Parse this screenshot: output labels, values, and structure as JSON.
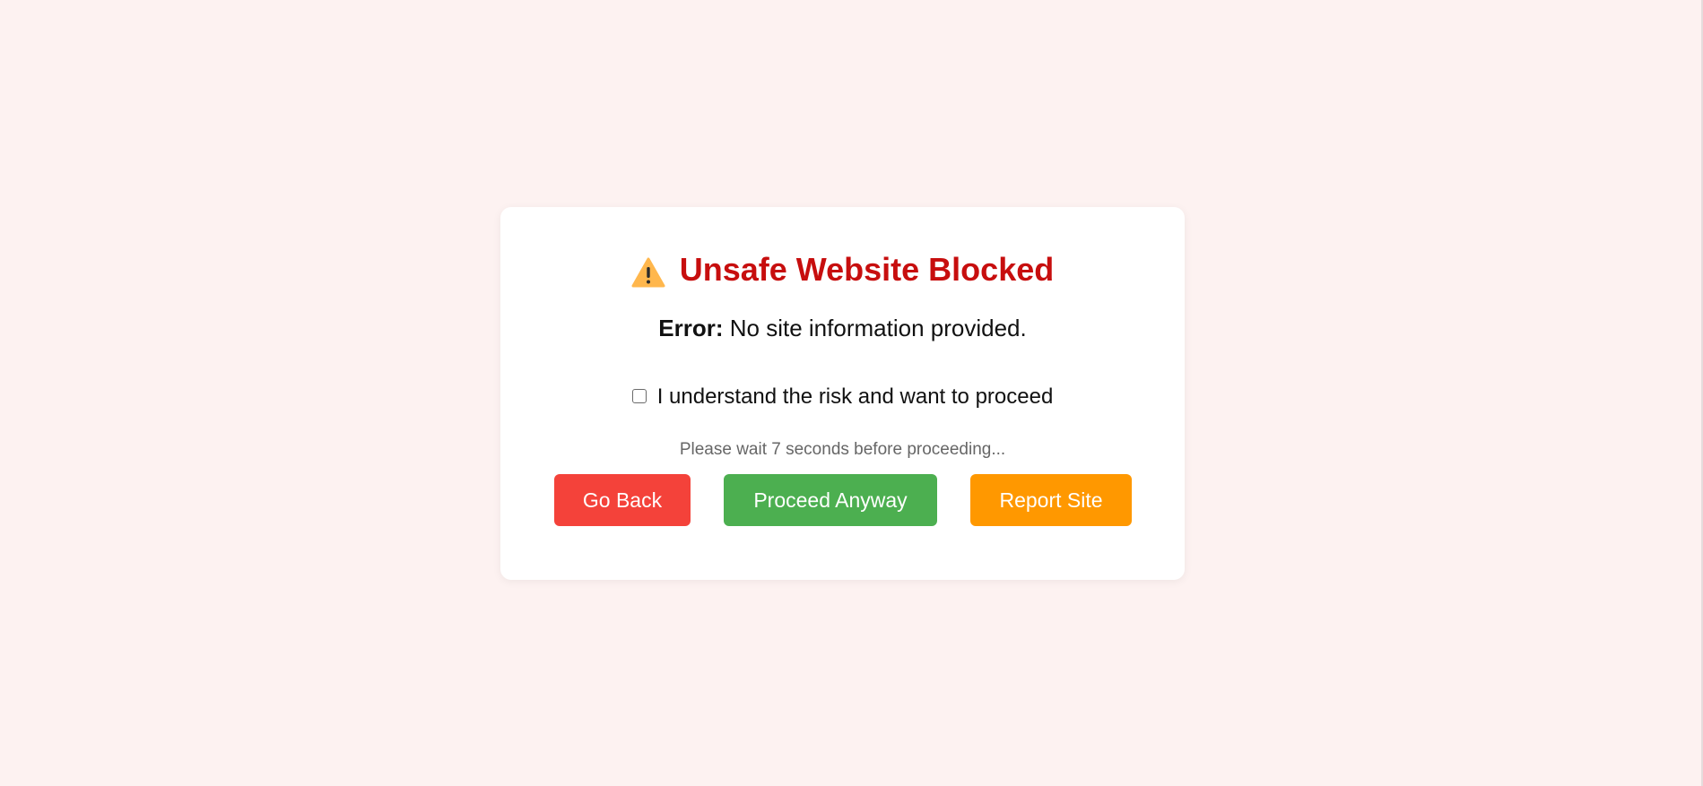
{
  "dialog": {
    "title": "Unsafe Website Blocked",
    "title_icon": "warning-icon",
    "error_label": "Error:",
    "error_message": "No site information provided.",
    "consent_checked": false,
    "consent_label": "I understand the risk and want to proceed",
    "wait_message": "Please wait 7 seconds before proceeding...",
    "buttons": {
      "back_label": "Go Back",
      "proceed_label": "Proceed Anyway",
      "report_label": "Report Site"
    }
  },
  "colors": {
    "page_background": "#fdf2f1",
    "title": "#c70e0e",
    "back_button": "#f4423a",
    "proceed_button": "#4caf50",
    "report_button": "#ff9800"
  }
}
